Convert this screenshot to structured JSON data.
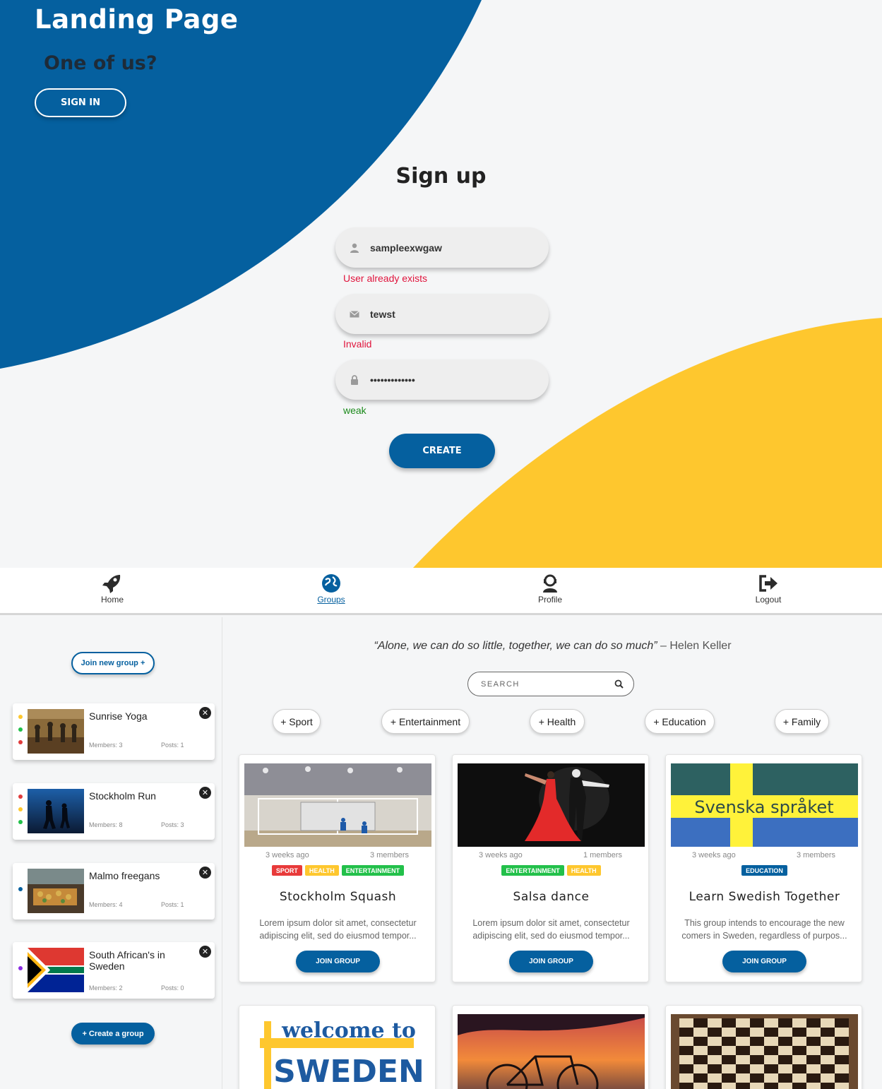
{
  "landing": {
    "title": "Landing Page",
    "subtitle": "One of us?",
    "signin_label": "SIGN IN",
    "signup_title": "Sign up",
    "username": {
      "value": "sampleexwgaw",
      "icon": "user-icon",
      "message": "User already exists"
    },
    "email": {
      "value": "tewst",
      "icon": "envelope-icon",
      "message": "Invalid"
    },
    "password": {
      "value": "•••••••••••••",
      "icon": "lock-icon",
      "message": "weak"
    },
    "create_label": "CREATE",
    "colors": {
      "blue": "#05609f",
      "yellow": "#fec72e",
      "error": "#e0143c",
      "ok": "#1b8a1b"
    }
  },
  "nav": {
    "items": [
      {
        "label": "Home",
        "icon": "rocket-icon"
      },
      {
        "label": "Groups",
        "icon": "globe-icon",
        "active": true
      },
      {
        "label": "Profile",
        "icon": "user-headset-icon"
      },
      {
        "label": "Logout",
        "icon": "logout-icon"
      }
    ]
  },
  "sidebar": {
    "join_new_label": "Join new group +",
    "create_group_label": "+ Create a group",
    "groups": [
      {
        "name": "Sunrise Yoga",
        "members": "Members: 3",
        "posts": "Posts: 1",
        "dots": [
          "#fec72e",
          "#22c04a",
          "#e03c3c"
        ]
      },
      {
        "name": "Stockholm Run",
        "members": "Members: 8",
        "posts": "Posts: 3",
        "dots": [
          "#e03c3c",
          "#fec72e",
          "#22c04a"
        ]
      },
      {
        "name": "Malmo freegans",
        "members": "Members: 4",
        "posts": "Posts: 1",
        "dots": [
          "#05609f"
        ]
      },
      {
        "name": "South African's in Sweden",
        "members": "Members: 2",
        "posts": "Posts: 0",
        "dots": [
          "#8a2be2"
        ]
      }
    ]
  },
  "main": {
    "quote": "“Alone, we can do so little, together, we can do so much”",
    "quote_author": " – Helen Keller",
    "search_placeholder": "SEARCH",
    "categories": [
      "+ Sport",
      "+ Entertainment",
      "+ Health",
      "+ Education",
      "+ Family"
    ],
    "cards": [
      {
        "time": "3 weeks ago",
        "members": "3 members",
        "tags": [
          {
            "label": "SPORT",
            "color": "#e83a3a"
          },
          {
            "label": "HEALTH",
            "color": "#fec72e"
          },
          {
            "label": "ENTERTAINMENT",
            "color": "#22c04a"
          }
        ],
        "title": "Stockholm Squash",
        "desc": "Lorem ipsum dolor sit amet, consectetur adipiscing elit, sed do eiusmod tempor...",
        "button": "JOIN GROUP"
      },
      {
        "time": "3 weeks ago",
        "members": "1 members",
        "tags": [
          {
            "label": "ENTERTAINMENT",
            "color": "#22c04a"
          },
          {
            "label": "HEALTH",
            "color": "#fec72e"
          }
        ],
        "title": "Salsa dance",
        "desc": "Lorem ipsum dolor sit amet, consectetur adipiscing elit, sed do eiusmod tempor...",
        "button": "JOIN GROUP"
      },
      {
        "time": "3 weeks ago",
        "members": "3 members",
        "tags": [
          {
            "label": "EDUCATION",
            "color": "#05609f"
          }
        ],
        "title": "Learn Swedish Together",
        "desc": "This group intends to encourage the new comers in Sweden, regardless of purpos...",
        "button": "JOIN GROUP",
        "image_text": "Svenska språket"
      }
    ],
    "more_cards": [
      {
        "image_text_1": "welcome to",
        "image_text_2": "SWEDEN"
      },
      {
        "image": "sunset-bicycle"
      },
      {
        "image": "chess-board"
      }
    ]
  }
}
